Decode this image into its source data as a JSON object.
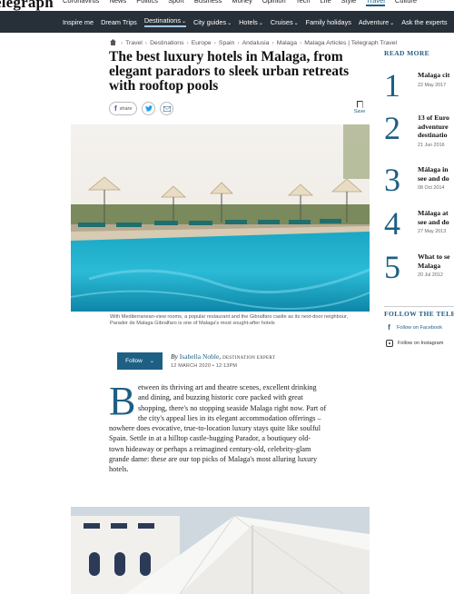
{
  "brand": {
    "logo_text": "elegraph"
  },
  "top_nav": [
    "Coronavirus",
    "News",
    "Politics",
    "Sport",
    "Business",
    "Money",
    "Opinion",
    "Tech",
    "Life",
    "Style",
    "Travel",
    "Culture"
  ],
  "top_nav_active": "Travel",
  "sub_nav": [
    {
      "label": "Inspire me",
      "dropdown": false
    },
    {
      "label": "Dream Trips",
      "dropdown": false
    },
    {
      "label": "Destinations",
      "dropdown": true
    },
    {
      "label": "City guides",
      "dropdown": true
    },
    {
      "label": "Hotels",
      "dropdown": true
    },
    {
      "label": "Cruises",
      "dropdown": true
    },
    {
      "label": "Family holidays",
      "dropdown": false
    },
    {
      "label": "Adventure",
      "dropdown": true
    },
    {
      "label": "Ask the experts",
      "dropdown": false
    }
  ],
  "breadcrumb": [
    "Travel",
    "Destinations",
    "Europe",
    "Spain",
    "Andalusia",
    "Malaga",
    "Malaga Articles | Telegraph Travel"
  ],
  "article": {
    "headline": "The best luxury hotels in Malaga, from elegant paradors to sleek urban retreats with rooftop pools",
    "share_label": "share",
    "save_label": "Save",
    "caption": "With Mediterranean-view rooms, a popular restaurant and the Gibralfaro castle as its next-door neighbour, Parador de Malaga Gibralfaro is one of Malaga's most sought-after hotels",
    "follow_label": "Follow",
    "byline_prefix": "By",
    "author": "Isabella Noble",
    "author_role": "DESTINATION EXPERT",
    "date": "12 MARCH 2020 • 12:13PM",
    "dropcap": "B",
    "body_lines": [
      "etween its thriving art and theatre scenes, excellent drinking",
      "and dining, and buzzing historic core packed with great",
      "shopping, there's no stopping seaside Malaga right now. Part of",
      "the city's appeal lies in its elegant accommodation offerings –",
      "nowhere does evocative, true-to-location luxury stays quite like soulful",
      "Spain. Settle in at a hilltop castle-hugging Parador, a boutiquey old-",
      "town hideaway or perhaps a reimagined century-old, celebrity-glam",
      "grande dame: these are our top picks of Malaga's most alluring luxury",
      "hotels."
    ]
  },
  "sidebar": {
    "read_more_label": "READ MORE",
    "items": [
      {
        "num": "1",
        "title_lines": [
          "Malaga cit"
        ],
        "date": "22 May 2017"
      },
      {
        "num": "2",
        "title_lines": [
          "13 of Euro",
          "adventure",
          "destinatio"
        ],
        "date": "21 Jun 2016"
      },
      {
        "num": "3",
        "title_lines": [
          "Málaga in",
          "see and do"
        ],
        "date": "08 Oct 2014"
      },
      {
        "num": "4",
        "title_lines": [
          "Málaga at",
          "see and do"
        ],
        "date": "27 May 2013"
      },
      {
        "num": "5",
        "title_lines": [
          "What to se",
          "Malaga"
        ],
        "date": "20 Jul 2012"
      }
    ],
    "follow_label": "FOLLOW THE TELEGRAPH",
    "facebook_label": "Follow on Facebook",
    "instagram_label": "Follow on Instagram"
  }
}
